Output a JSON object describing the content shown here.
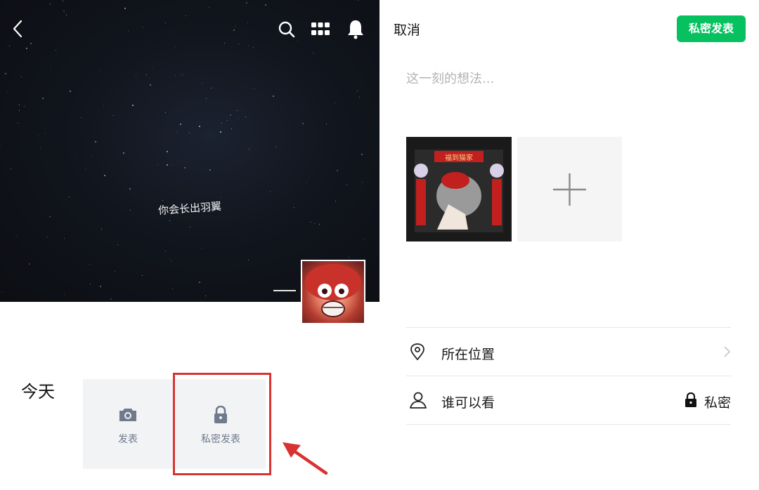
{
  "left_panel": {
    "cover": {
      "caption": "你会长出羽翼"
    },
    "today_label": "今天",
    "post_button_label": "发表",
    "private_post_button_label": "私密发表"
  },
  "right_panel": {
    "header": {
      "cancel_label": "取消",
      "publish_label": "私密发表"
    },
    "compose": {
      "placeholder": "这一刻的想法..."
    },
    "thumbnail": {
      "banner_text": "福到猫家"
    },
    "options": {
      "location_label": "所在位置",
      "visibility_label": "谁可以看",
      "visibility_value": "私密"
    }
  },
  "colors": {
    "publish_green": "#07c160",
    "highlight_red": "#d93232",
    "icon_gray_blue": "#6f7a8c"
  }
}
